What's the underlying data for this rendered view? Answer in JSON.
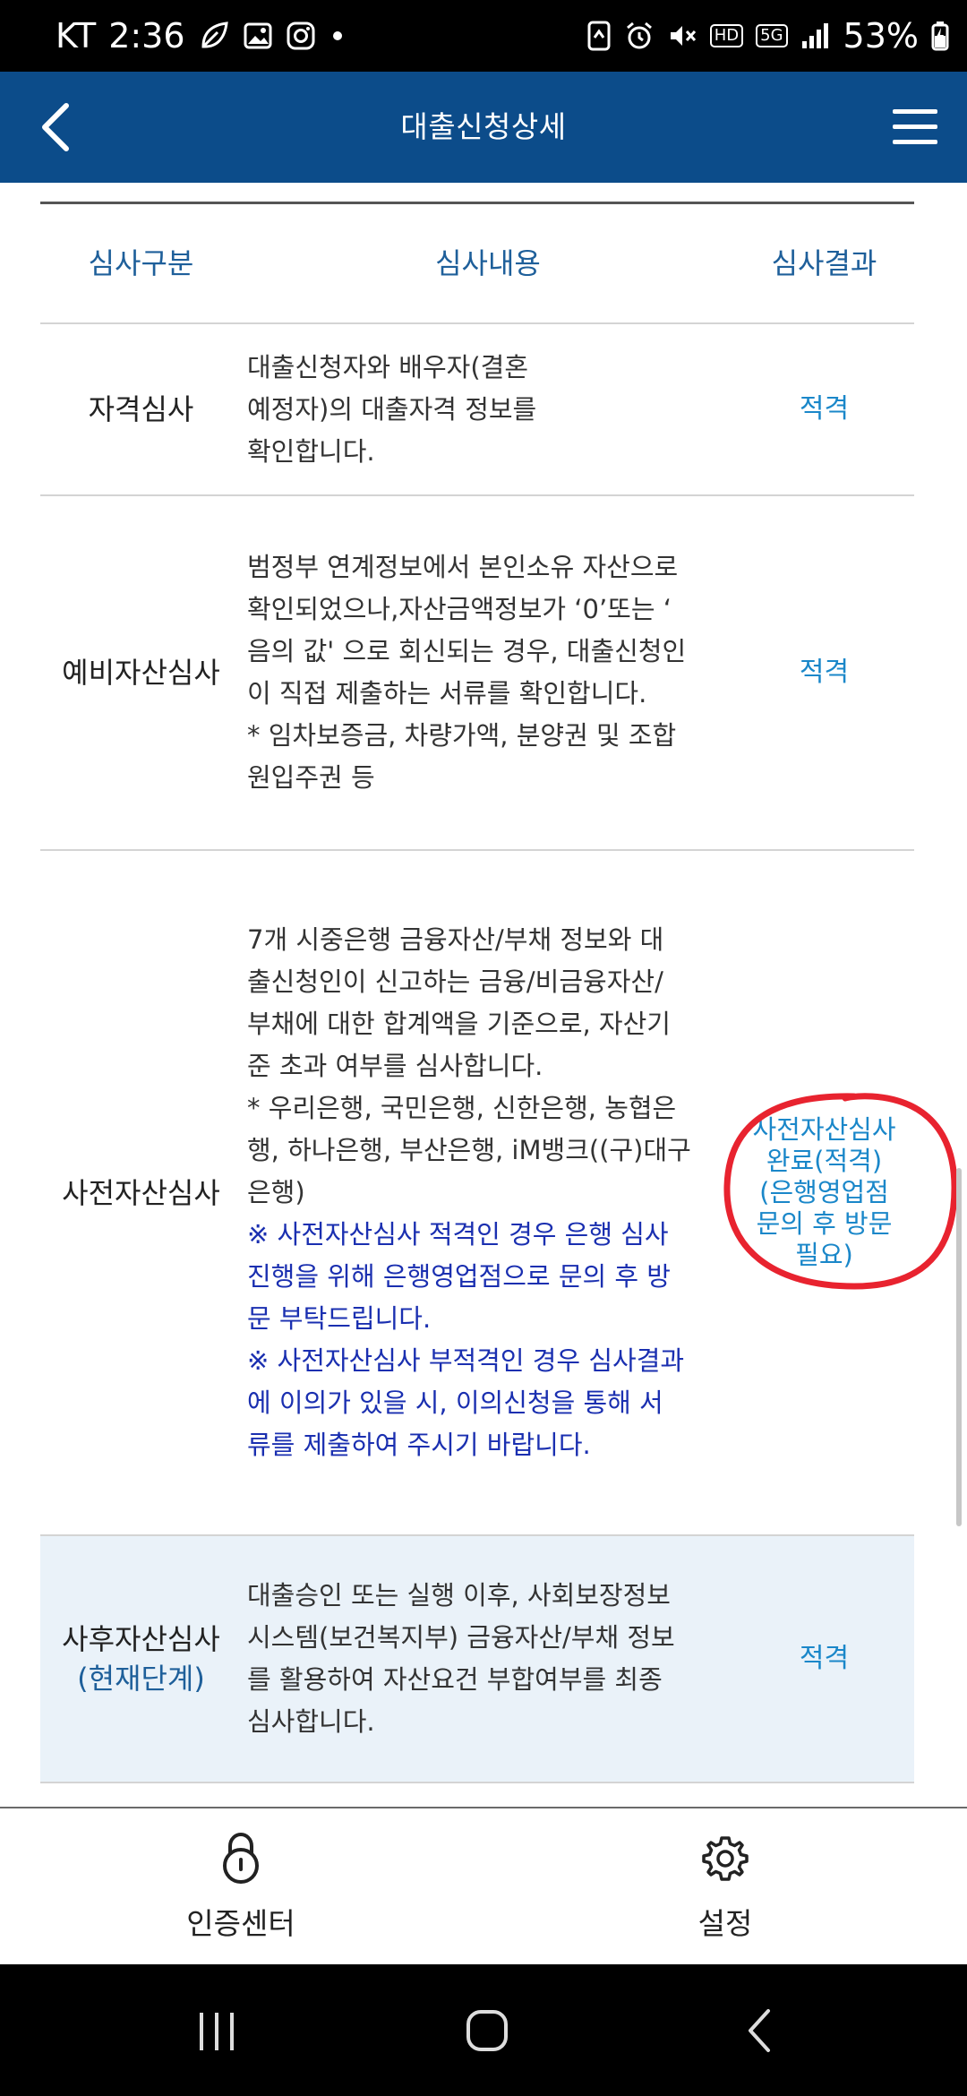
{
  "status_bar": {
    "carrier": "KT",
    "time": "2:36",
    "network": "5G",
    "hd_label": "HD",
    "battery": "53%",
    "colors": {
      "background": "#000000",
      "text": "#ffffff"
    }
  },
  "header": {
    "title": "대출신청상세",
    "back_icon": "chevron-left-icon",
    "menu_icon": "hamburger-menu-icon",
    "background": "#0c4c8a"
  },
  "table": {
    "columns": [
      "심사구분",
      "심사내용",
      "심사결과"
    ],
    "rows": [
      {
        "type": "자격심사",
        "content": [
          "대출신청자와 배우자(결혼",
          "예정자)의 대출자격 정보를",
          "확인합니다."
        ],
        "result": "적격"
      },
      {
        "type": "예비자산심사",
        "content": [
          "범정부 연계정보에서 본인소유 자산으로",
          " 확인되었으나,자산금액정보가 ‘0’또는 ‘",
          "음의 값' 으로 회신되는 경우, 대출신청인",
          "이 직접 제출하는 서류를 확인합니다.",
          "* 임차보증금, 차량가액, 분양권 및 조합",
          "원입주권 등"
        ],
        "result": "적격"
      },
      {
        "type": "사전자산심사",
        "content": [
          "7개 시중은행 금융자산/부채 정보와 대",
          "출신청인이 신고하는 금융/비금융자산/",
          "부채에 대한 합계액을 기준으로, 자산기",
          "준 초과 여부를 심사합니다.",
          "* 우리은행, 국민은행, 신한은행, 농협은",
          "행, 하나은행, 부산은행, iM뱅크((구)대구",
          "은행)"
        ],
        "notes": [
          "※ 사전자산심사 적격인 경우 은행 심사",
          "진행을 위해 은행영업점으로 문의 후 방",
          "문 부탁드립니다.",
          "※ 사전자산심사 부적격인 경우 심사결과",
          "에 이의가 있을 시, 이의신청을 통해 서",
          "류를 제출하여 주시기 바랍니다."
        ],
        "result_lines": [
          "사전자산심사",
          "완료(적격)",
          "(은행영업점",
          "문의 후 방문",
          "필요)"
        ]
      },
      {
        "type": "사후자산심사",
        "stage_note": "(현재단계)",
        "content": [
          "대출승인 또는 실행 이후, 사회보장정보",
          "시스템(보건복지부) 금융자산/부채 정보",
          "를 활용하여 자산요건 부합여부를 최종",
          "심사합니다."
        ],
        "result": "적격"
      }
    ],
    "colors": {
      "header_text": "#1e5f9a",
      "result_text": "#1a87c9",
      "note_text": "#1a2fb0",
      "current_row_bg": "#eaf2f9"
    }
  },
  "annotation": {
    "color": "#e8232f",
    "shape": "hand-drawn-circle"
  },
  "bottom_nav": {
    "items": [
      {
        "label": "인증센터",
        "icon": "lock-icon"
      },
      {
        "label": "설정",
        "icon": "gear-icon"
      }
    ]
  },
  "system_nav": {
    "buttons": [
      "recent-apps-icon",
      "home-icon",
      "back-icon"
    ]
  }
}
